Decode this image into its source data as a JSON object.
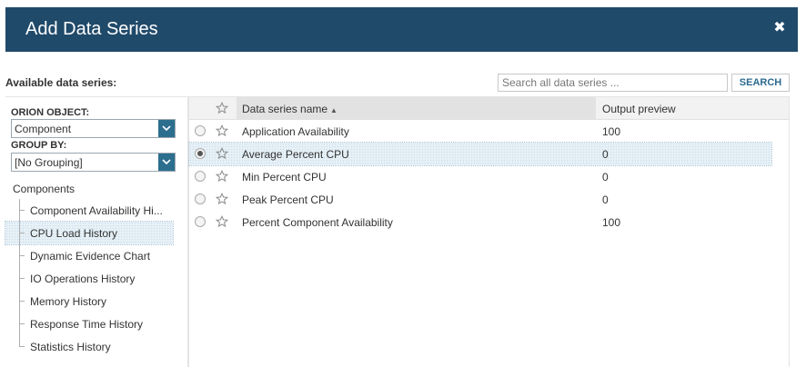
{
  "dialog": {
    "title": "Add Data Series",
    "close_icon": "close-icon"
  },
  "available_label": "Available data series:",
  "search": {
    "placeholder": "Search all data series ...",
    "value": "",
    "button_label": "SEARCH"
  },
  "filters": {
    "orion_object_label": "ORION OBJECT:",
    "orion_object_value": "Component",
    "group_by_label": "GROUP BY:",
    "group_by_value": "[No Grouping]"
  },
  "tree": {
    "root_label": "Components",
    "items": [
      {
        "label": "Component Availability Hi...",
        "selected": false
      },
      {
        "label": "CPU Load History",
        "selected": true
      },
      {
        "label": "Dynamic Evidence Chart",
        "selected": false
      },
      {
        "label": "IO Operations History",
        "selected": false
      },
      {
        "label": "Memory History",
        "selected": false
      },
      {
        "label": "Response Time History",
        "selected": false
      },
      {
        "label": "Statistics History",
        "selected": false
      }
    ]
  },
  "grid": {
    "columns": {
      "favorite_icon": "star-icon",
      "name": "Data series name",
      "name_sort_indicator": "▲",
      "output": "Output preview"
    },
    "rows": [
      {
        "name": "Application Availability",
        "output": "100",
        "selected": false
      },
      {
        "name": "Average Percent CPU",
        "output": "0",
        "selected": true
      },
      {
        "name": "Min Percent CPU",
        "output": "0",
        "selected": false
      },
      {
        "name": "Peak Percent CPU",
        "output": "0",
        "selected": false
      },
      {
        "name": "Percent Component Availability",
        "output": "100",
        "selected": false
      }
    ]
  },
  "colors": {
    "header_bg": "#204a6a",
    "accent": "#2c6e8e",
    "selection_bg": "#e6f0f6"
  }
}
